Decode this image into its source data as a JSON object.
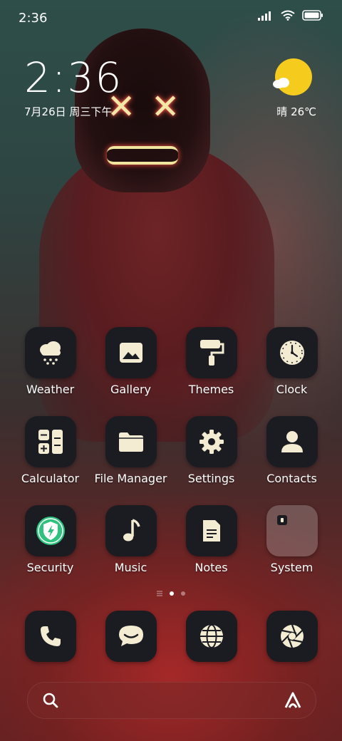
{
  "status_bar": {
    "time": "2:36"
  },
  "clock_widget": {
    "time": "2:36",
    "date": "7月26日 周三下午"
  },
  "weather_widget": {
    "text": "晴 26℃",
    "icon": "sunny-partly-cloudy-icon"
  },
  "apps": [
    {
      "label": "Weather",
      "icon": "weather-icon"
    },
    {
      "label": "Gallery",
      "icon": "gallery-icon"
    },
    {
      "label": "Themes",
      "icon": "themes-icon"
    },
    {
      "label": "Clock",
      "icon": "clock-icon"
    },
    {
      "label": "Calculator",
      "icon": "calculator-icon"
    },
    {
      "label": "File Manager",
      "icon": "folder-icon"
    },
    {
      "label": "Settings",
      "icon": "gear-icon"
    },
    {
      "label": "Contacts",
      "icon": "contact-icon"
    },
    {
      "label": "Security",
      "icon": "shield-icon"
    },
    {
      "label": "Music",
      "icon": "music-note-icon"
    },
    {
      "label": "Notes",
      "icon": "notes-icon"
    },
    {
      "label": "System",
      "icon": "system-folder-icon"
    }
  ],
  "dock": [
    {
      "icon": "phone-icon"
    },
    {
      "icon": "messages-icon"
    },
    {
      "icon": "browser-icon"
    },
    {
      "icon": "camera-icon"
    }
  ],
  "colors": {
    "icon_bg": "#1a1c22",
    "glyph": "#f3ecd3",
    "sun": "#f5cc1e",
    "security_green": "#2ec27e"
  }
}
